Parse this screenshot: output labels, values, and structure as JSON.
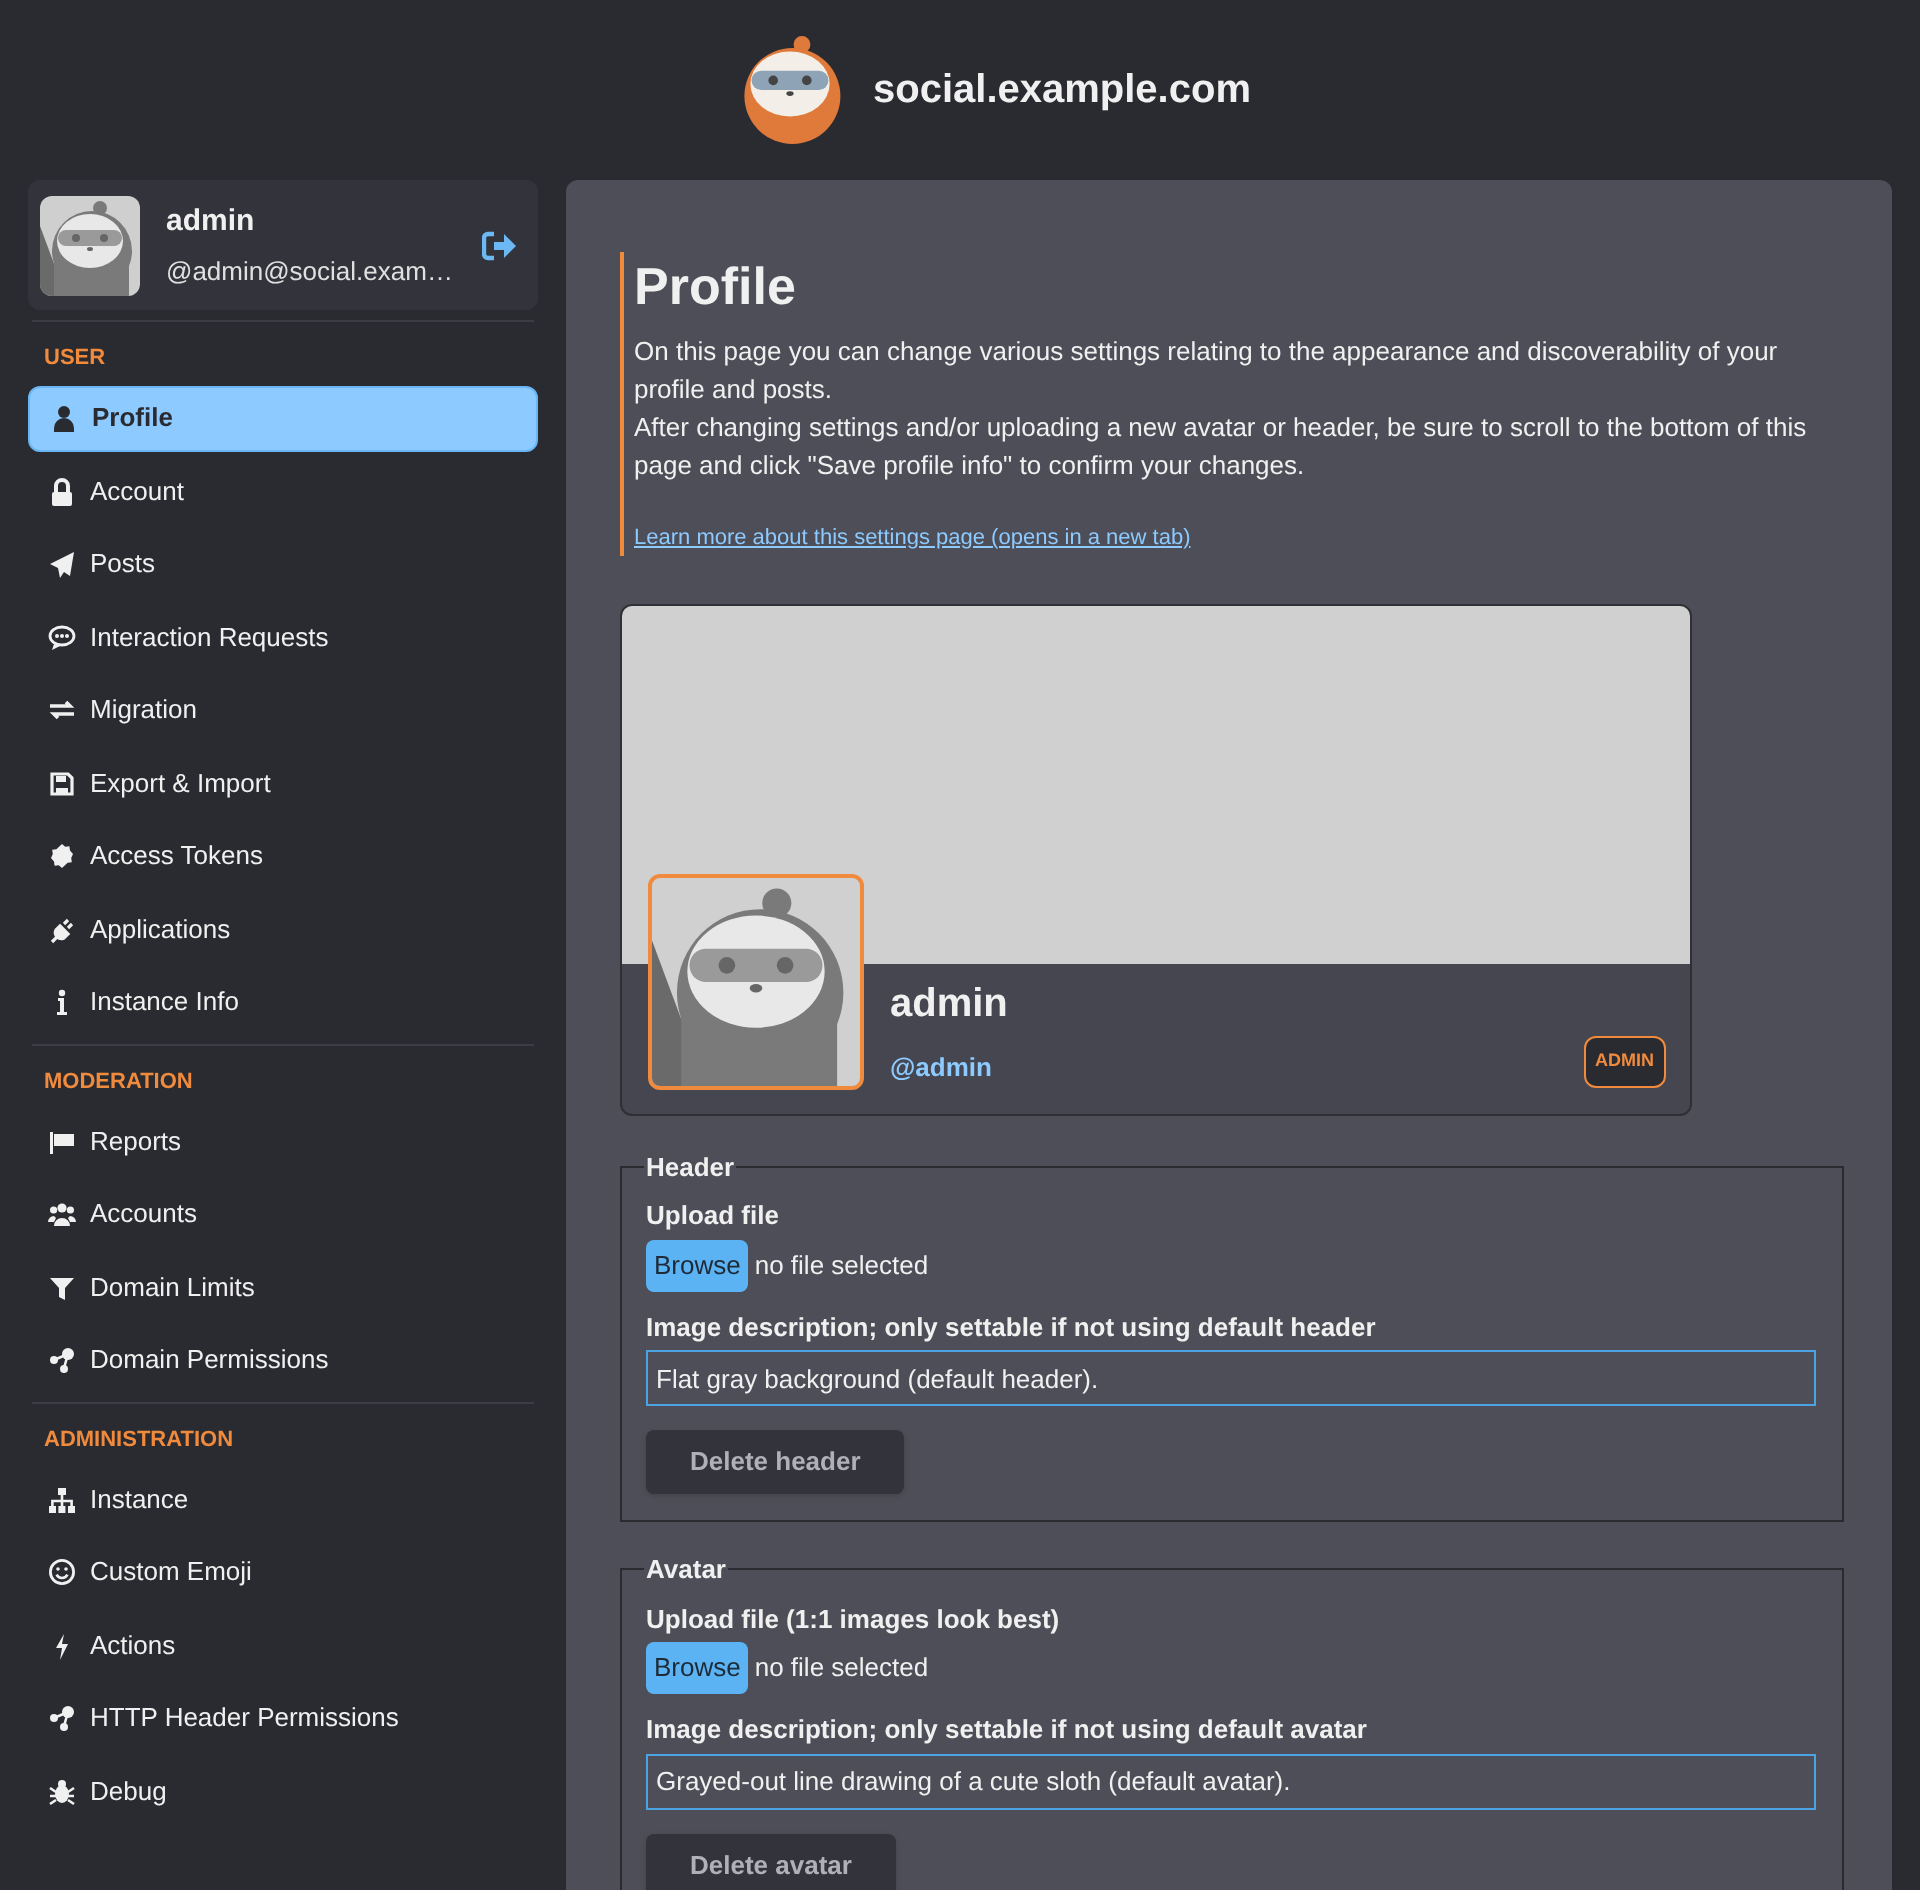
{
  "site": {
    "title": "social.example.com"
  },
  "account": {
    "name": "admin",
    "handle": "@admin@social.exam…"
  },
  "nav": [
    {
      "heading": "USER",
      "items": [
        {
          "label": "Profile",
          "selected": true
        },
        {
          "label": "Account",
          "selected": false
        },
        {
          "label": "Posts",
          "selected": false
        },
        {
          "label": "Interaction Requests",
          "selected": false
        },
        {
          "label": "Migration",
          "selected": false
        },
        {
          "label": "Export & Import",
          "selected": false
        },
        {
          "label": "Access Tokens",
          "selected": false
        },
        {
          "label": "Applications",
          "selected": false
        },
        {
          "label": "Instance Info",
          "selected": false
        }
      ]
    },
    {
      "heading": "MODERATION",
      "items": [
        {
          "label": "Reports",
          "selected": false
        },
        {
          "label": "Accounts",
          "selected": false
        },
        {
          "label": "Domain Limits",
          "selected": false
        },
        {
          "label": "Domain Permissions",
          "selected": false
        }
      ]
    },
    {
      "heading": "ADMINISTRATION",
      "items": [
        {
          "label": "Instance",
          "selected": false
        },
        {
          "label": "Custom Emoji",
          "selected": false
        },
        {
          "label": "Actions",
          "selected": false
        },
        {
          "label": "HTTP Header Permissions",
          "selected": false
        },
        {
          "label": "Debug",
          "selected": false
        }
      ]
    }
  ],
  "page": {
    "title": "Profile",
    "paragraphs": [
      "On this page you can change various settings relating to the appearance and discoverability of your profile and posts.",
      "After changing settings and/or uploading a new avatar or header, be sure to scroll to the bottom of this page and click \"Save profile info\" to confirm your changes."
    ],
    "help_link": "Learn more about this settings page (opens in a new tab)"
  },
  "preview": {
    "display_name": "admin",
    "username": "@admin",
    "badge": "ADMIN"
  },
  "sections": [
    {
      "legend": "Header",
      "upload_label": "Upload file",
      "browse": "Browse",
      "file_status": "no file selected",
      "description_label": "Image description; only settable if not using default header",
      "description_value": "Flat gray background (default header).",
      "delete_button": "Delete header"
    },
    {
      "legend": "Avatar",
      "upload_label": "Upload file (1:1 images look best)",
      "browse": "Browse",
      "file_status": "no file selected",
      "description_label": "Image description; only settable if not using default avatar",
      "description_value": "Grayed-out line drawing of a cute sloth (default avatar).",
      "delete_button": "Delete avatar"
    }
  ]
}
